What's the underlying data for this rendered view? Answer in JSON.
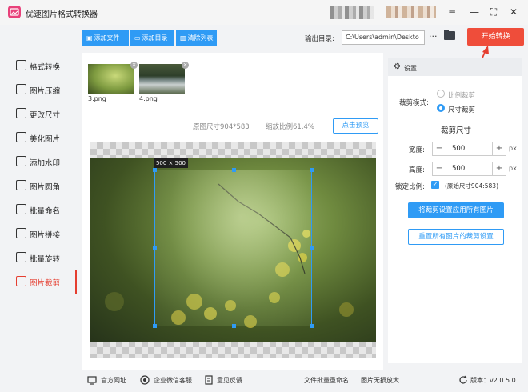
{
  "app": {
    "title": "优速图片格式转换器"
  },
  "window_controls": {
    "menu": "≡",
    "minimize": "—",
    "maximize": "⛶",
    "close": "✕"
  },
  "toolbar": {
    "add_file": "添加文件",
    "add_folder": "添加目录",
    "clear_list": "清除列表",
    "output_label": "输出目录:",
    "output_path": "C:\\Users\\admin\\Deskto",
    "more": "···",
    "start": "开始转换"
  },
  "sidebar": {
    "items": [
      {
        "label": "格式转换",
        "icon": "format-convert-icon"
      },
      {
        "label": "图片压缩",
        "icon": "compress-icon"
      },
      {
        "label": "更改尺寸",
        "icon": "resize-icon"
      },
      {
        "label": "美化图片",
        "icon": "beautify-icon"
      },
      {
        "label": "添加水印",
        "icon": "watermark-icon"
      },
      {
        "label": "图片圆角",
        "icon": "rounded-corner-icon"
      },
      {
        "label": "批量命名",
        "icon": "rename-icon"
      },
      {
        "label": "图片拼接",
        "icon": "stitch-icon"
      },
      {
        "label": "批量旋转",
        "icon": "rotate-icon"
      },
      {
        "label": "图片裁剪",
        "icon": "crop-icon",
        "active": true
      }
    ]
  },
  "files": [
    {
      "name": "3.png"
    },
    {
      "name": "4.png"
    }
  ],
  "preview": {
    "original_size": "原图尺寸904*583",
    "scale": "缩放比例61.4%",
    "preview_button": "点击预览",
    "crop_label": "500 × 500"
  },
  "settings": {
    "header": "设置",
    "crop_mode_label": "裁剪模式:",
    "mode_ratio": "比例裁剪",
    "mode_size": "尺寸裁剪",
    "selected_mode": "尺寸裁剪",
    "section_title": "裁剪尺寸",
    "width_label": "宽度:",
    "width_value": "500",
    "height_label": "高度:",
    "height_value": "500",
    "unit": "px",
    "lock_label": "锁定比例:",
    "lock_checked": true,
    "original_size_note": "(原始尺寸904:583)",
    "apply_all": "将裁剪设置应用所有图片",
    "reset_all": "重置所有图片的裁剪设置"
  },
  "footer": {
    "website": "官方网址",
    "wechat_service": "企业微信客服",
    "feedback": "意见反馈",
    "batch_rename": "文件批量重命名",
    "lossless_enlarge": "图片无损放大",
    "version": "版本：v2.0.5.0"
  },
  "colors": {
    "accent": "#2f9bf5",
    "start_button": "#ef4d3a",
    "active": "#e53e30"
  }
}
